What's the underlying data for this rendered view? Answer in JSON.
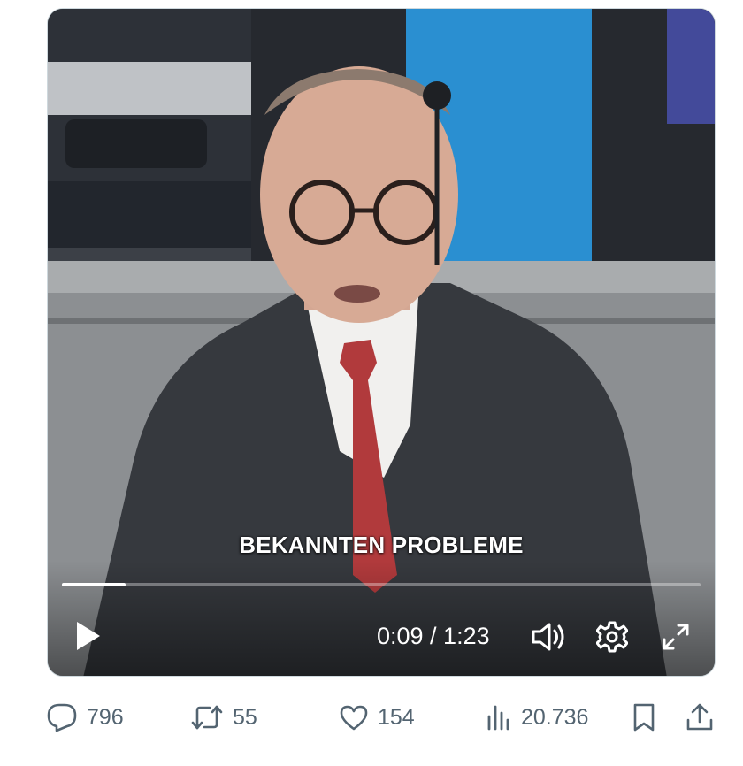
{
  "video": {
    "caption": "BEKANNTEN PROBLEME",
    "progress_fraction": 0.1,
    "time_label": "0:09 / 1:23",
    "controls": {
      "play_icon": "play-icon",
      "volume_icon": "volume-icon",
      "settings_icon": "gear-icon",
      "fullscreen_icon": "expand-icon"
    }
  },
  "actions": {
    "replies": "796",
    "reposts": "55",
    "likes": "154",
    "views": "20.736"
  },
  "colors": {
    "icon": "#536471",
    "video_control": "#ffffff"
  }
}
